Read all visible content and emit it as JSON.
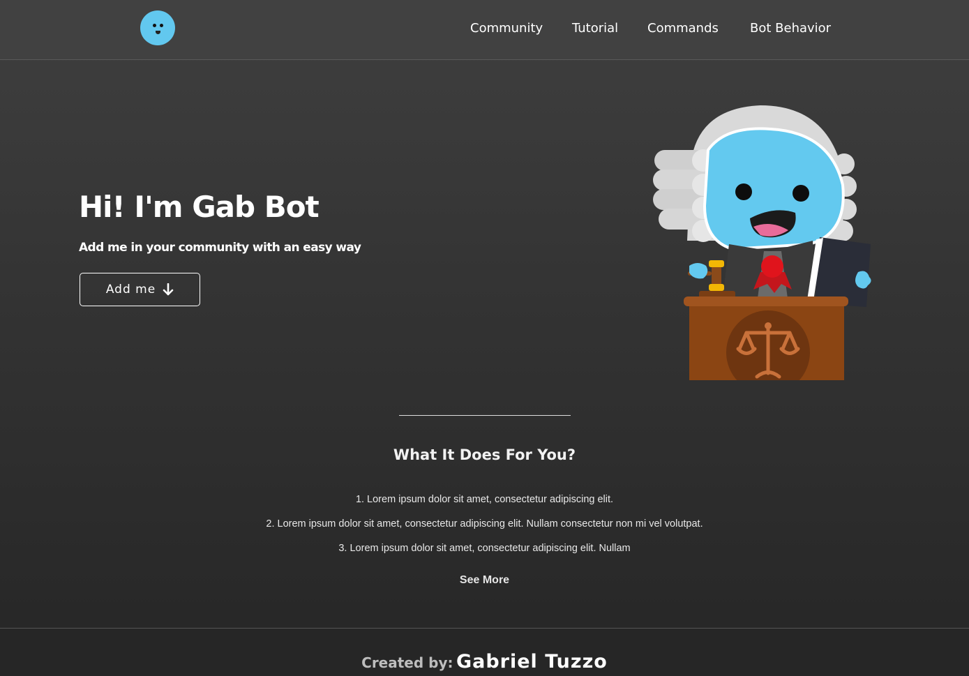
{
  "header": {
    "logo_icon": "smiling-bot-face-icon",
    "logo_color": "#62c8ef",
    "nav": [
      {
        "label": "Community"
      },
      {
        "label": "Tutorial"
      },
      {
        "label": "Commands"
      },
      {
        "label": "Bot Behavior"
      }
    ]
  },
  "hero": {
    "title": "Hi! I'm Gab Bot",
    "subtitle": "Add me in your community with an easy way",
    "add_button_label": "Add me",
    "add_button_icon": "arrow-down-icon",
    "illustration": "judge-bot-illustration"
  },
  "features": {
    "title": "What It Does For You?",
    "items": [
      "1. Lorem ipsum dolor sit amet, consectetur adipiscing elit.",
      "2. Lorem ipsum dolor sit amet, consectetur adipiscing elit. Nullam consectetur non mi vel volutpat.",
      "3. Lorem ipsum dolor sit amet, consectetur adipiscing elit. Nullam"
    ],
    "see_more_label": "See More"
  },
  "footer": {
    "label": "Created by:",
    "name": "Gabriel Tuzzo"
  },
  "colors": {
    "background": "#3a3a3a",
    "accent": "#62c8ef"
  }
}
